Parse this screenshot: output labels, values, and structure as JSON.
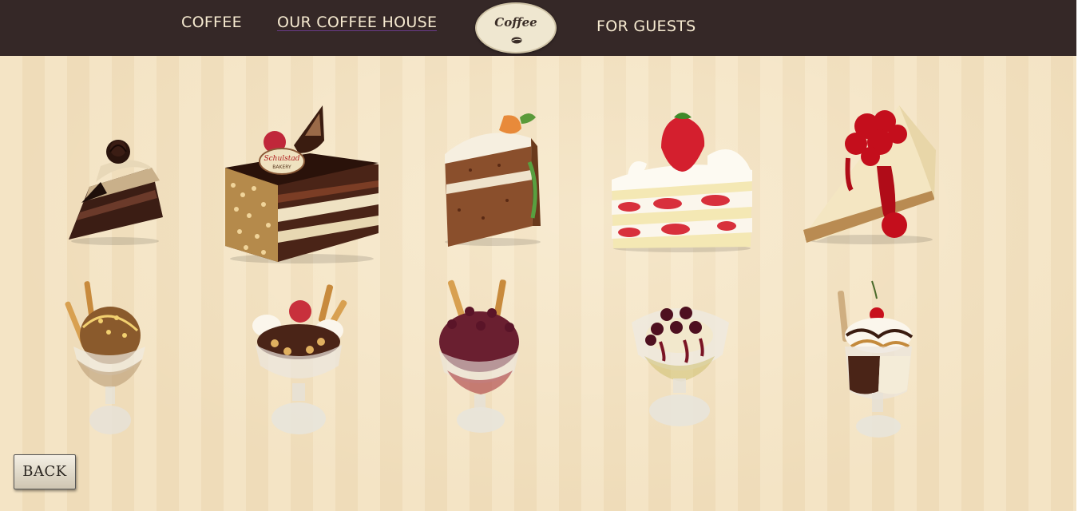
{
  "nav": {
    "items": [
      {
        "label": "COFFEE"
      },
      {
        "label": "OUR COFFEE HOUSE"
      },
      {
        "label": "FOR GUESTS"
      }
    ],
    "logo_text": "Coffee"
  },
  "gallery": {
    "cakes": [
      {
        "name": "chocolate-cream-cake"
      },
      {
        "name": "chocolate-layer-cake",
        "badge_line1": "Schulstad",
        "badge_line2": "BAKERY"
      },
      {
        "name": "carrot-cake"
      },
      {
        "name": "strawberry-shortcake"
      },
      {
        "name": "cherry-cheesecake"
      }
    ],
    "sundaes": [
      {
        "name": "caramel-nut-sundae"
      },
      {
        "name": "hazelnut-cream-sundae"
      },
      {
        "name": "chocolate-cherry-sundae"
      },
      {
        "name": "cherry-vanilla-sundae"
      },
      {
        "name": "caramel-chocolate-sundae"
      }
    ]
  },
  "back_button": {
    "label": "BACK"
  },
  "colors": {
    "navbar": "#352827",
    "nav_text": "#f6ead0",
    "background": "#f3e3c3",
    "logo_bg": "#efe7d0"
  }
}
